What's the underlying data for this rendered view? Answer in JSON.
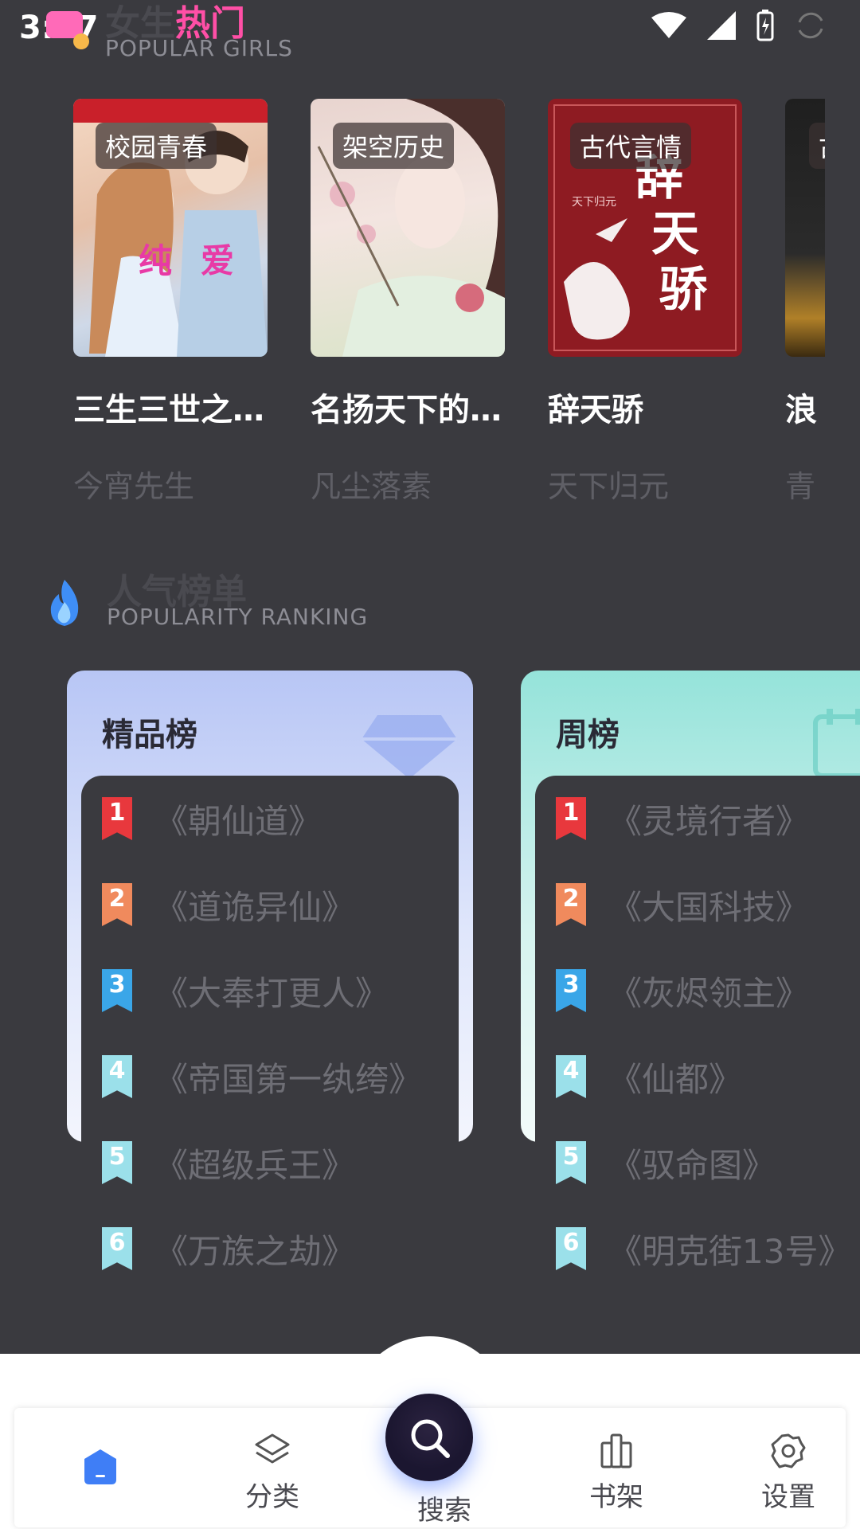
{
  "status": {
    "time": "3:27"
  },
  "popular_girls": {
    "title_prefix": "女生",
    "title_hot": "热门",
    "subtitle": "POPULAR GIRLS",
    "books": [
      {
        "tag": "校园青春",
        "title": "三生三世之...",
        "author": "今宵先生"
      },
      {
        "tag": "架空历史",
        "title": "名扬天下的...",
        "author": "凡尘落素"
      },
      {
        "tag": "古代言情",
        "title": "辞天骄",
        "author": "天下归元"
      },
      {
        "tag": "古",
        "title": "浪",
        "author": "青"
      }
    ]
  },
  "ranking": {
    "title": "人气榜单",
    "subtitle": "POPULARITY RANKING",
    "lists": [
      {
        "name": "精品榜",
        "items": [
          "《朝仙道》",
          "《道诡异仙》",
          "《大奉打更人》",
          "《帝国第一纨绔》",
          "《超级兵王》",
          "《万族之劫》"
        ]
      },
      {
        "name": "周榜",
        "items": [
          "《灵境行者》",
          "《大国科技》",
          "《灰烬领主》",
          "《仙都》",
          "《驭命图》",
          "《明克街13号》"
        ]
      }
    ],
    "rank_numbers": [
      "1",
      "2",
      "3",
      "4",
      "5",
      "6"
    ]
  },
  "nav": {
    "items": [
      {
        "label": "",
        "icon": "home-icon"
      },
      {
        "label": "分类",
        "icon": "layers-icon"
      },
      {
        "label": "搜索",
        "icon": "search-icon"
      },
      {
        "label": "书架",
        "icon": "bookshelf-icon"
      },
      {
        "label": "设置",
        "icon": "settings-icon"
      }
    ]
  },
  "colors": {
    "accent_pink": "#ff4fa6",
    "rank1": "#e8383d",
    "rank2": "#f08a5d",
    "rank3": "#3aa6e8",
    "rank_other": "#9be0ea",
    "nav_active": "#3f7ef6"
  }
}
